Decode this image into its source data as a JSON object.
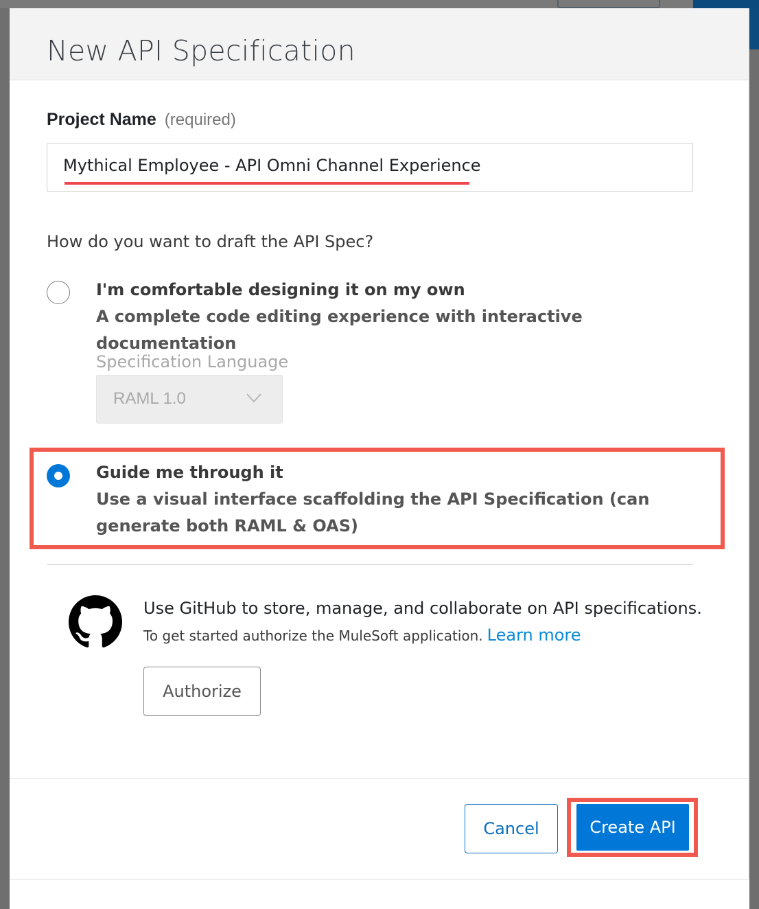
{
  "modal": {
    "title": "New API Specification"
  },
  "project": {
    "label": "Project Name",
    "required_hint": "(required)",
    "value": "Mythical Employee - API Omni Channel Experience"
  },
  "draft": {
    "question": "How do you want to draft the API Spec?",
    "options": [
      {
        "title": "I'm comfortable designing it on my own",
        "description": "A complete code editing experience with interactive documentation",
        "selected": false
      },
      {
        "title": "Guide me through it",
        "description": "Use a visual interface scaffolding the API Specification (can generate both RAML & OAS)",
        "selected": true
      }
    ],
    "spec_language_label": "Specification Language",
    "spec_language_value": "RAML 1.0"
  },
  "github": {
    "icon": "github-icon",
    "title": "Use GitHub to store, manage, and collaborate on API specifications.",
    "subtitle": "To get started authorize the MuleSoft application.",
    "link": "Learn more",
    "authorize_label": "Authorize"
  },
  "footer": {
    "cancel_label": "Cancel",
    "create_label": "Create API"
  },
  "colors": {
    "primary": "#0177d7",
    "annotation": "#f05a4f",
    "link": "#0a8bd6"
  }
}
